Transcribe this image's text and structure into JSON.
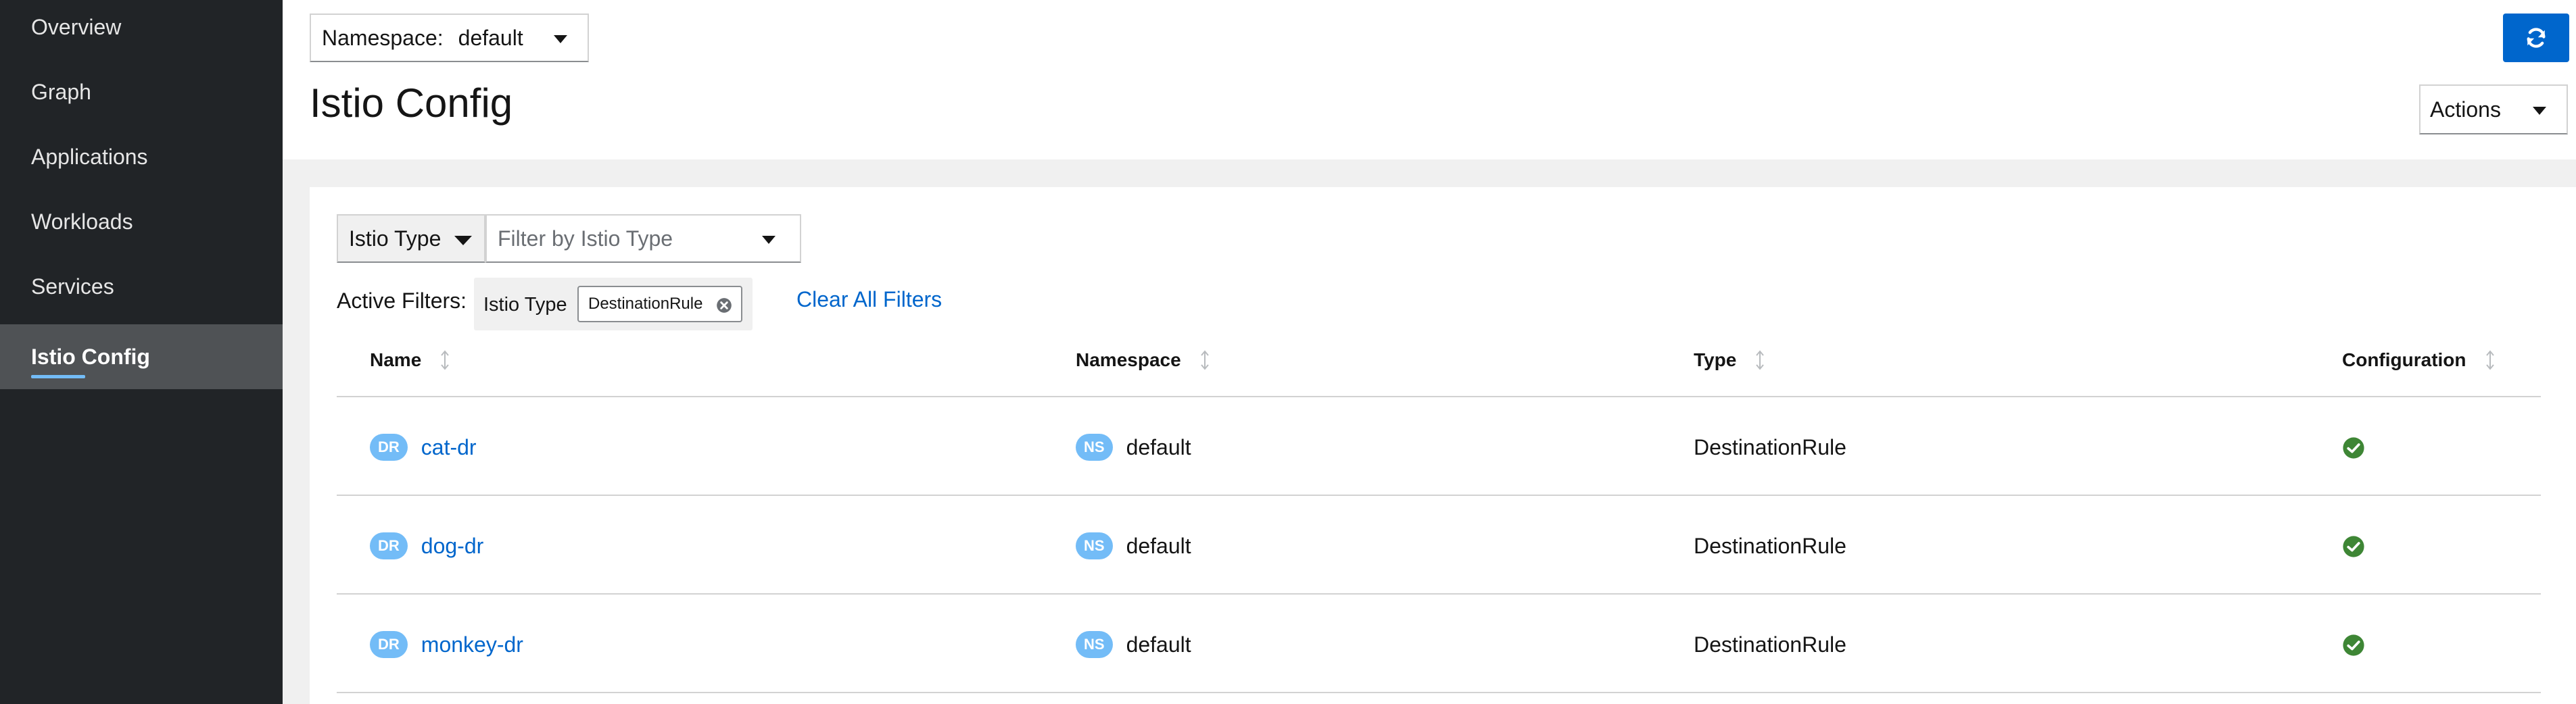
{
  "sidebar": {
    "items": [
      {
        "label": "Overview"
      },
      {
        "label": "Graph"
      },
      {
        "label": "Applications"
      },
      {
        "label": "Workloads"
      },
      {
        "label": "Services"
      },
      {
        "label": "Istio Config",
        "active": true
      }
    ]
  },
  "header": {
    "namespace_label": "Namespace:",
    "namespace_value": "default",
    "title": "Istio Config",
    "actions_label": "Actions"
  },
  "filters": {
    "type_select": "Istio Type",
    "placeholder": "Filter by Istio Type",
    "active_label": "Active Filters:",
    "chip_category": "Istio Type",
    "chip_value": "DestinationRule",
    "clear_all": "Clear All Filters"
  },
  "table": {
    "columns": [
      "Name",
      "Namespace",
      "Type",
      "Configuration"
    ],
    "rows": [
      {
        "badge": "DR",
        "name": "cat-dr",
        "ns_badge": "NS",
        "namespace": "default",
        "type": "DestinationRule",
        "config": "valid"
      },
      {
        "badge": "DR",
        "name": "dog-dr",
        "ns_badge": "NS",
        "namespace": "default",
        "type": "DestinationRule",
        "config": "valid"
      },
      {
        "badge": "DR",
        "name": "monkey-dr",
        "ns_badge": "NS",
        "namespace": "default",
        "type": "DestinationRule",
        "config": "valid"
      }
    ]
  },
  "colors": {
    "link": "#0066cc",
    "badge": "#73bcf7",
    "ok": "#3e8635",
    "sidebar": "#212427",
    "primary": "#0066cc"
  }
}
